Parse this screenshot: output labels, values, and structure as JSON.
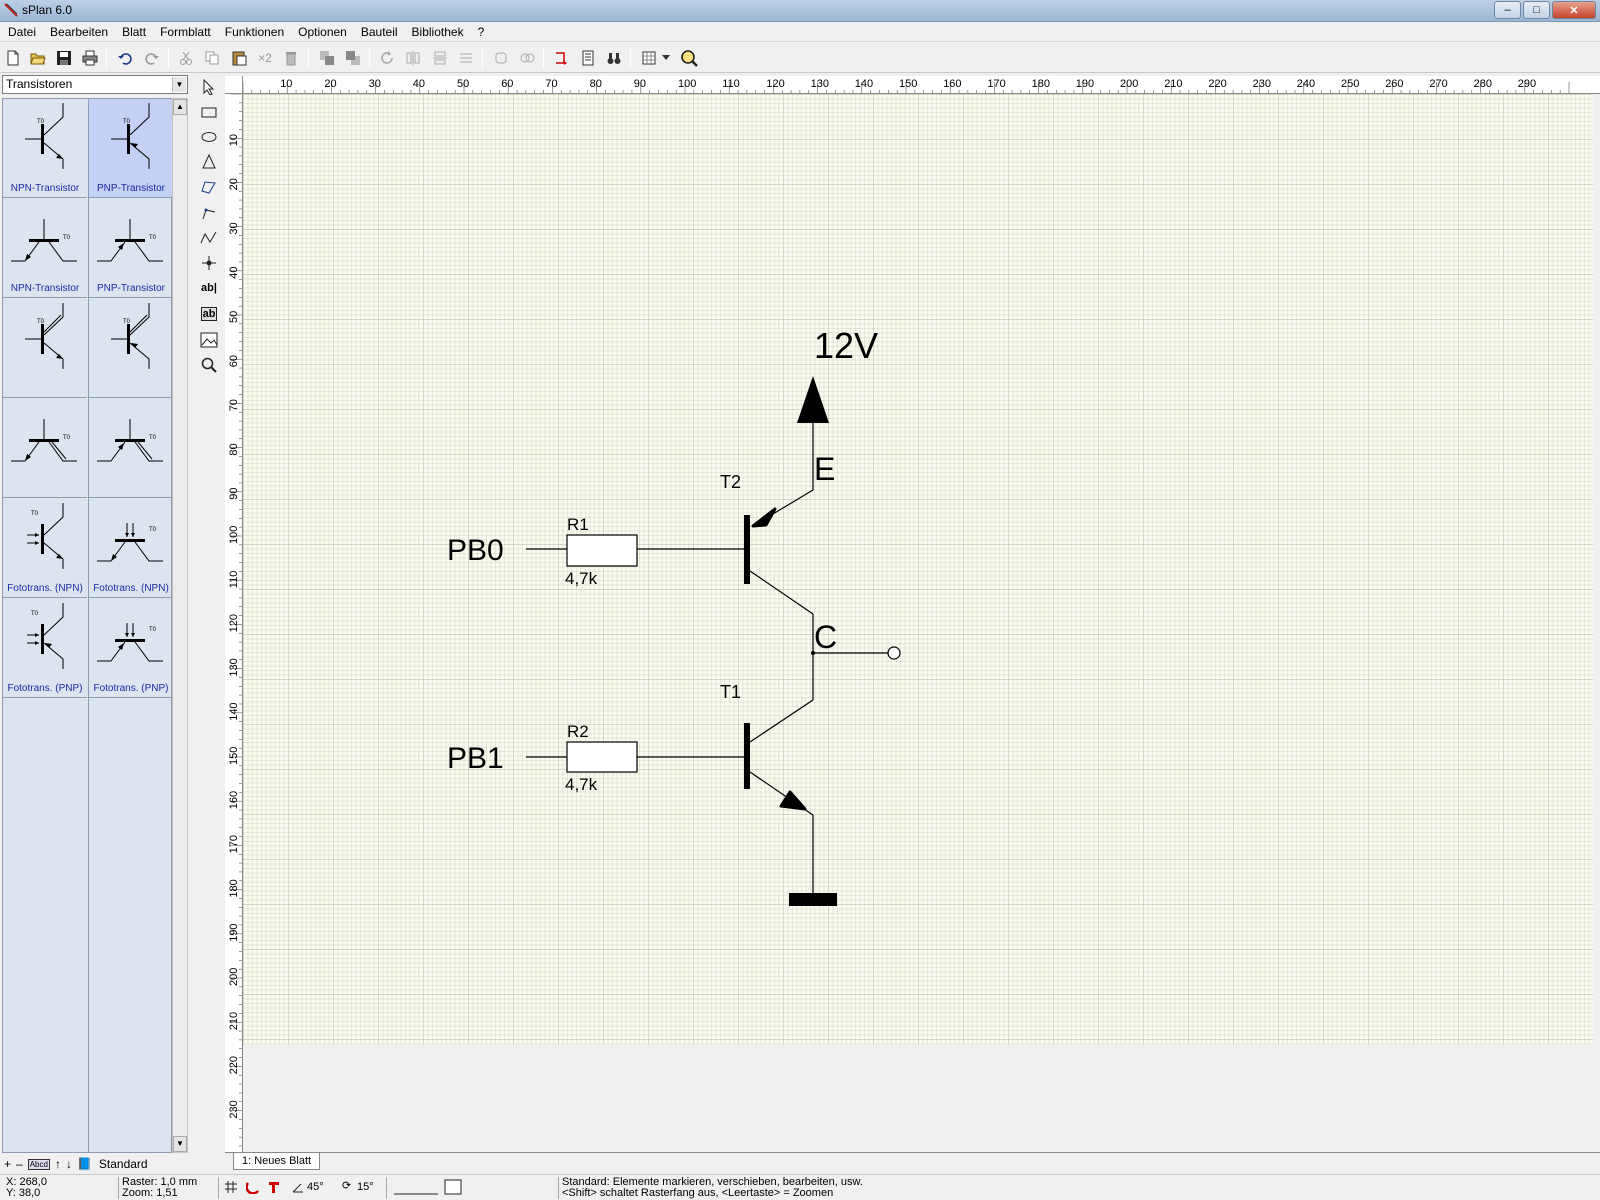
{
  "window": {
    "title": "sPlan 6.0"
  },
  "menu": [
    "Datei",
    "Bearbeiten",
    "Blatt",
    "Formblatt",
    "Funktionen",
    "Optionen",
    "Bauteil",
    "Bibliothek",
    "?"
  ],
  "library": {
    "category": "Transistoren",
    "cells": [
      {
        "label": "NPN-Transistor",
        "symbol": "npn-vertical",
        "selected": false
      },
      {
        "label": "PNP-Transistor",
        "symbol": "pnp-vertical",
        "selected": true
      },
      {
        "label": "NPN-Transistor",
        "symbol": "npn-horizontal",
        "selected": false
      },
      {
        "label": "PNP-Transistor",
        "symbol": "pnp-horizontal",
        "selected": false
      },
      {
        "label": "",
        "symbol": "npn-double-collector",
        "selected": false
      },
      {
        "label": "",
        "symbol": "pnp-double-collector",
        "selected": false
      },
      {
        "label": "",
        "symbol": "npn-horizontal-double",
        "selected": false
      },
      {
        "label": "",
        "symbol": "pnp-horizontal-double",
        "selected": false
      },
      {
        "label": "Fototrans. (NPN)",
        "symbol": "photo-npn-vertical",
        "selected": false
      },
      {
        "label": "Fototrans. (NPN)",
        "symbol": "photo-npn-horizontal",
        "selected": false
      },
      {
        "label": "Fototrans. (PNP)",
        "symbol": "photo-pnp-vertical",
        "selected": false
      },
      {
        "label": "Fototrans. (PNP)",
        "symbol": "photo-pnp-horizontal",
        "selected": false
      }
    ],
    "footer_library": "Standard"
  },
  "rulers": {
    "h_labels": [
      "10",
      "20",
      "30",
      "40",
      "50",
      "60",
      "70",
      "80",
      "90",
      "100",
      "110",
      "120",
      "130",
      "140",
      "150",
      "160",
      "170",
      "180",
      "190",
      "200",
      "210",
      "220",
      "230",
      "240",
      "250",
      "260",
      "270",
      "280",
      "290"
    ],
    "v_labels": [
      "10",
      "20",
      "30",
      "40",
      "50",
      "60",
      "70",
      "80",
      "90",
      "100",
      "110",
      "120",
      "130",
      "140",
      "150",
      "160",
      "170",
      "180",
      "190",
      "200",
      "210",
      "220",
      "230"
    ]
  },
  "schematic": {
    "supply_label": "12V",
    "emitter_label": "E",
    "collector_label": "C",
    "t2_label": "T2",
    "t1_label": "T1",
    "r1_label": "R1",
    "r1_value": "4,7k",
    "r2_label": "R2",
    "r2_value": "4,7k",
    "pb0_label": "PB0",
    "pb1_label": "PB1"
  },
  "sheet_tab": "1: Neues Blatt",
  "status": {
    "x": "X: 268,0",
    "y": "Y: 38,0",
    "raster": "Raster:  1,0 mm",
    "zoom": "Zoom:   1,51",
    "angle1": "45°",
    "angle2": "15°",
    "hint1": "Standard: Elemente markieren, verschieben, bearbeiten, usw.",
    "hint2": "<Shift> schaltet Rasterfang aus, <Leertaste> = Zoomen"
  }
}
